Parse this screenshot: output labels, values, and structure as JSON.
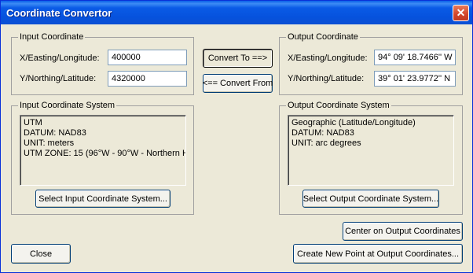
{
  "window": {
    "title": "Coordinate Convertor",
    "close_glyph": "✕"
  },
  "input_coordinate": {
    "legend": "Input Coordinate",
    "x_label": "X/Easting/Longitude:",
    "x_value": "400000",
    "y_label": "Y/Northing/Latitude:",
    "y_value": "4320000"
  },
  "output_coordinate": {
    "legend": "Output Coordinate",
    "x_label": "X/Easting/Longitude:",
    "x_value": "94° 09' 18.7466'' W",
    "y_label": "Y/Northing/Latitude:",
    "y_value": "39° 01' 23.9772'' N"
  },
  "convert": {
    "to_label": "Convert To ==>",
    "from_label": "<== Convert From"
  },
  "input_system": {
    "legend": "Input Coordinate System",
    "lines": [
      "UTM",
      "DATUM: NAD83",
      "UNIT: meters",
      "UTM ZONE: 15 (96°W - 90°W - Northern H"
    ],
    "select_label": "Select Input Coordinate System..."
  },
  "output_system": {
    "legend": "Output Coordinate System",
    "lines": [
      "Geographic (Latitude/Longitude)",
      "DATUM: NAD83",
      "UNIT: arc degrees"
    ],
    "select_label": "Select Output Coordinate System..."
  },
  "footer": {
    "center_label": "Center on Output Coordinates",
    "close_label": "Close",
    "create_point_label": "Create New Point at Output Coordinates..."
  },
  "colors": {
    "title_bar": "#0a5be6",
    "dialog_bg": "#ece9d8",
    "close_button": "#d2452a"
  }
}
